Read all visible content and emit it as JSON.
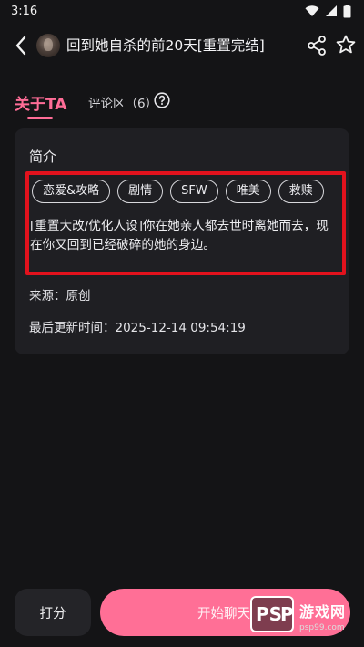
{
  "status": {
    "time": "3:16"
  },
  "header": {
    "title": "回到她自杀的前20天[重置完结]"
  },
  "tabs": {
    "about": "关于TA",
    "comments": "评论区（6）"
  },
  "card": {
    "title": "简介",
    "tags": [
      "恋爱&攻略",
      "剧情",
      "SFW",
      "唯美",
      "救赎"
    ],
    "description": "[重置大改/优化人设]你在她亲人都去世时离她而去，现在你又回到已经破碎的她的身边。",
    "source": "来源：原创",
    "updated": "最后更新时间：2025-12-14 09:54:19"
  },
  "bottom": {
    "rate_label": "打分",
    "chat_label": "开始聊天"
  },
  "watermark": {
    "title": "游戏网",
    "url": "psp99.com"
  },
  "colors": {
    "accent": "#ff6d97",
    "highlight_box": "#e2121d",
    "background": "#141416",
    "card": "#1f1f23"
  },
  "icons": [
    "back-arrow-icon",
    "share-icon",
    "star-icon",
    "help-icon",
    "wifi-icon",
    "signal-icon",
    "battery-icon"
  ]
}
